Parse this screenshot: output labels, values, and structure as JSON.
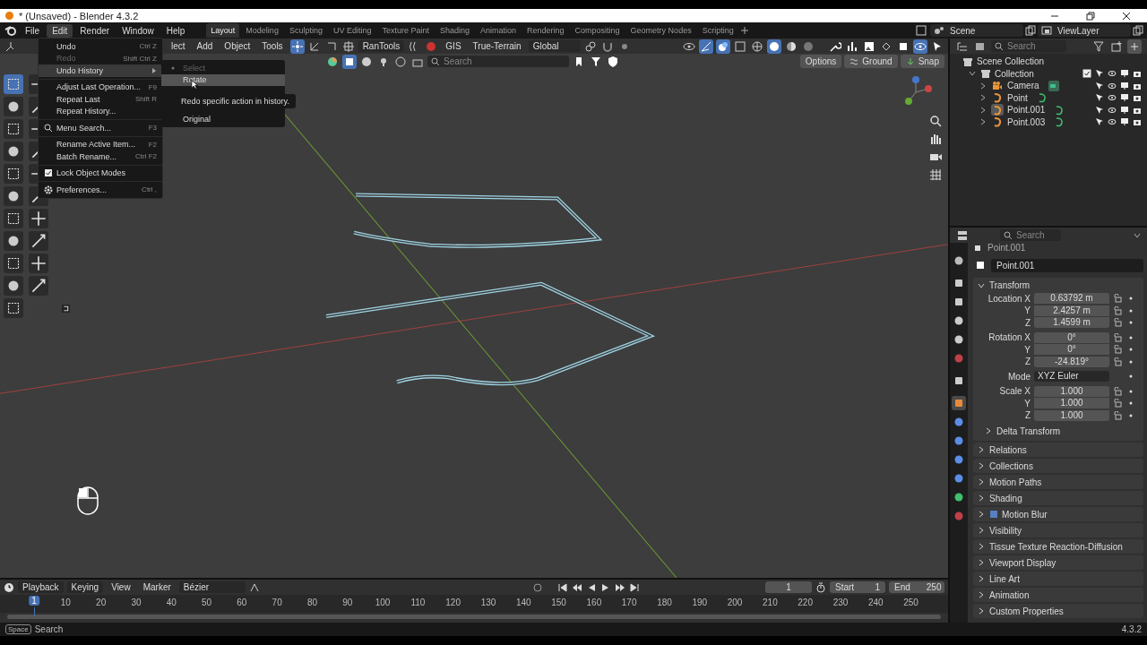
{
  "window": {
    "title": "* (Unsaved) - Blender 4.3.2"
  },
  "menubar": [
    {
      "label": "File",
      "selected": false
    },
    {
      "label": "Edit",
      "selected": true
    },
    {
      "label": "Render",
      "selected": false
    },
    {
      "label": "Window",
      "selected": false
    },
    {
      "label": "Help",
      "selected": false
    }
  ],
  "workspaces": [
    {
      "label": "Layout",
      "selected": true
    },
    {
      "label": "Modeling",
      "selected": false
    },
    {
      "label": "Sculpting",
      "selected": false
    },
    {
      "label": "UV Editing",
      "selected": false
    },
    {
      "label": "Texture Paint",
      "selected": false
    },
    {
      "label": "Shading",
      "selected": false
    },
    {
      "label": "Animation",
      "selected": false
    },
    {
      "label": "Rendering",
      "selected": false
    },
    {
      "label": "Compositing",
      "selected": false
    },
    {
      "label": "Geometry Nodes",
      "selected": false
    },
    {
      "label": "Scripting",
      "selected": false
    }
  ],
  "scene": "Scene",
  "view_layer": "ViewLayer",
  "viewport_header": {
    "menus": [
      "lect",
      "Add",
      "Object",
      "Tools"
    ],
    "addons": [
      "RanTools",
      "GIS",
      "True-Terrain"
    ],
    "orientation": "Global",
    "search_placeholder": "Search",
    "options": "Options",
    "ground": "Ground",
    "snap": "Snap"
  },
  "edit_menu": [
    {
      "kind": "item",
      "label": "Undo",
      "shortcut": "Ctrl Z",
      "disabled": false,
      "selected": false
    },
    {
      "kind": "item",
      "label": "Redo",
      "shortcut": "Shift Ctrl Z",
      "disabled": true,
      "selected": false
    },
    {
      "kind": "submenu",
      "label": "Undo History",
      "disabled": false,
      "selected": true
    },
    {
      "kind": "separator"
    },
    {
      "kind": "item",
      "label": "Adjust Last Operation...",
      "shortcut": "F9",
      "disabled": false,
      "selected": false
    },
    {
      "kind": "item",
      "label": "Repeat Last",
      "shortcut": "Shift R",
      "disabled": false,
      "selected": false
    },
    {
      "kind": "item",
      "label": "Repeat History...",
      "disabled": false,
      "selected": false
    },
    {
      "kind": "separator"
    },
    {
      "kind": "search",
      "label": "Menu Search...",
      "shortcut": "F3",
      "disabled": false,
      "selected": false
    },
    {
      "kind": "separator"
    },
    {
      "kind": "item",
      "label": "Rename Active Item...",
      "shortcut": "F2",
      "disabled": false,
      "selected": false
    },
    {
      "kind": "item",
      "label": "Batch Rename...",
      "shortcut": "Ctrl F2",
      "disabled": false,
      "selected": false
    },
    {
      "kind": "separator"
    },
    {
      "kind": "check",
      "label": "Lock Object Modes",
      "checked": true,
      "disabled": false,
      "selected": false
    },
    {
      "kind": "separator"
    },
    {
      "kind": "settings",
      "label": "Preferences...",
      "shortcut": "Ctrl ,",
      "disabled": false,
      "selected": false
    }
  ],
  "undo_history": {
    "items": [
      {
        "label": "Select",
        "disabled": true,
        "selected": false
      },
      {
        "label": "Rotate",
        "disabled": false,
        "selected": true
      }
    ],
    "tooltip": "Redo specific action in history.",
    "original": "Original"
  },
  "outliner": {
    "search_placeholder": "Search",
    "root": "Scene Collection",
    "collection": {
      "label": "Collection",
      "expanded": true,
      "checked": true,
      "children": [
        {
          "label": "Camera",
          "kind": "camera",
          "selected": false,
          "expanded": false
        },
        {
          "label": "Point",
          "kind": "curve",
          "selected": false,
          "expanded": false
        },
        {
          "label": "Point.001",
          "kind": "curve",
          "selected": true,
          "expanded": false
        },
        {
          "label": "Point.003",
          "kind": "curve",
          "selected": false,
          "expanded": false
        }
      ]
    }
  },
  "properties": {
    "search_placeholder": "Search",
    "breadcrumb": "Point.001",
    "object_name": "Point.001",
    "tabs": [
      {
        "kind": "tool",
        "selected": false
      },
      {
        "kind": "render",
        "selected": false
      },
      {
        "kind": "output",
        "selected": false
      },
      {
        "kind": "view_layer",
        "selected": false
      },
      {
        "kind": "scene",
        "selected": false
      },
      {
        "kind": "world",
        "selected": false
      },
      {
        "kind": "collection",
        "selected": false
      },
      {
        "kind": "object",
        "selected": true
      },
      {
        "kind": "modifier",
        "selected": false
      },
      {
        "kind": "particles",
        "selected": false
      },
      {
        "kind": "physics",
        "selected": false
      },
      {
        "kind": "constraint",
        "selected": false
      },
      {
        "kind": "data",
        "selected": false
      },
      {
        "kind": "material",
        "selected": false
      }
    ],
    "transform": {
      "title": "Transform",
      "expanded": true,
      "groups": [
        {
          "rows": [
            {
              "kind": "number",
              "label": "Location X",
              "value": "0.63792 m"
            },
            {
              "kind": "number",
              "label": "Y",
              "value": "2.4257 m"
            },
            {
              "kind": "number",
              "label": "Z",
              "value": "1.4599 m"
            }
          ]
        },
        {
          "rows": [
            {
              "kind": "number",
              "label": "Rotation X",
              "value": "0°"
            },
            {
              "kind": "number",
              "label": "Y",
              "value": "0°"
            },
            {
              "kind": "number",
              "label": "Z",
              "value": "-24.819°"
            }
          ]
        },
        {
          "rows": [
            {
              "kind": "dropdown",
              "label": "Mode",
              "value": "XYZ Euler"
            }
          ]
        },
        {
          "rows": [
            {
              "kind": "number",
              "label": "Scale X",
              "value": "1.000"
            },
            {
              "kind": "number",
              "label": "Y",
              "value": "1.000"
            },
            {
              "kind": "number",
              "label": "Z",
              "value": "1.000"
            }
          ]
        }
      ],
      "subpanels": [
        {
          "label": "Delta Transform",
          "expanded": false
        }
      ]
    },
    "panels": [
      {
        "kind": "plain",
        "label": "Relations",
        "expanded": false
      },
      {
        "kind": "plain",
        "label": "Collections",
        "expanded": false
      },
      {
        "kind": "plain",
        "label": "Motion Paths",
        "expanded": false
      },
      {
        "kind": "plain",
        "label": "Shading",
        "expanded": false
      },
      {
        "kind": "check",
        "label": "Motion Blur",
        "checked": true,
        "expanded": false
      },
      {
        "kind": "plain",
        "label": "Visibility",
        "expanded": false
      },
      {
        "kind": "plain",
        "label": "Tissue Texture Reaction-Diffusion",
        "expanded": false
      },
      {
        "kind": "plain",
        "label": "Viewport Display",
        "expanded": false
      },
      {
        "kind": "plain",
        "label": "Line Art",
        "expanded": false
      },
      {
        "kind": "plain",
        "label": "Animation",
        "expanded": false
      },
      {
        "kind": "plain",
        "label": "Custom Properties",
        "expanded": false
      }
    ]
  },
  "timeline": {
    "menus": [
      "Playback",
      "Keying",
      "View",
      "Marker"
    ],
    "interpolation": "Bézier",
    "current_frame": "1",
    "start_label": "Start",
    "start": "1",
    "end_label": "End",
    "end": "250",
    "playhead": "1",
    "ticks": [
      "10",
      "20",
      "30",
      "40",
      "50",
      "60",
      "70",
      "80",
      "90",
      "100",
      "110",
      "120",
      "130",
      "140",
      "150",
      "160",
      "170",
      "180",
      "190",
      "200",
      "210",
      "220",
      "230",
      "240",
      "250"
    ]
  },
  "status_bar": {
    "key": "Space",
    "label": "Search",
    "version": "4.3.2"
  }
}
